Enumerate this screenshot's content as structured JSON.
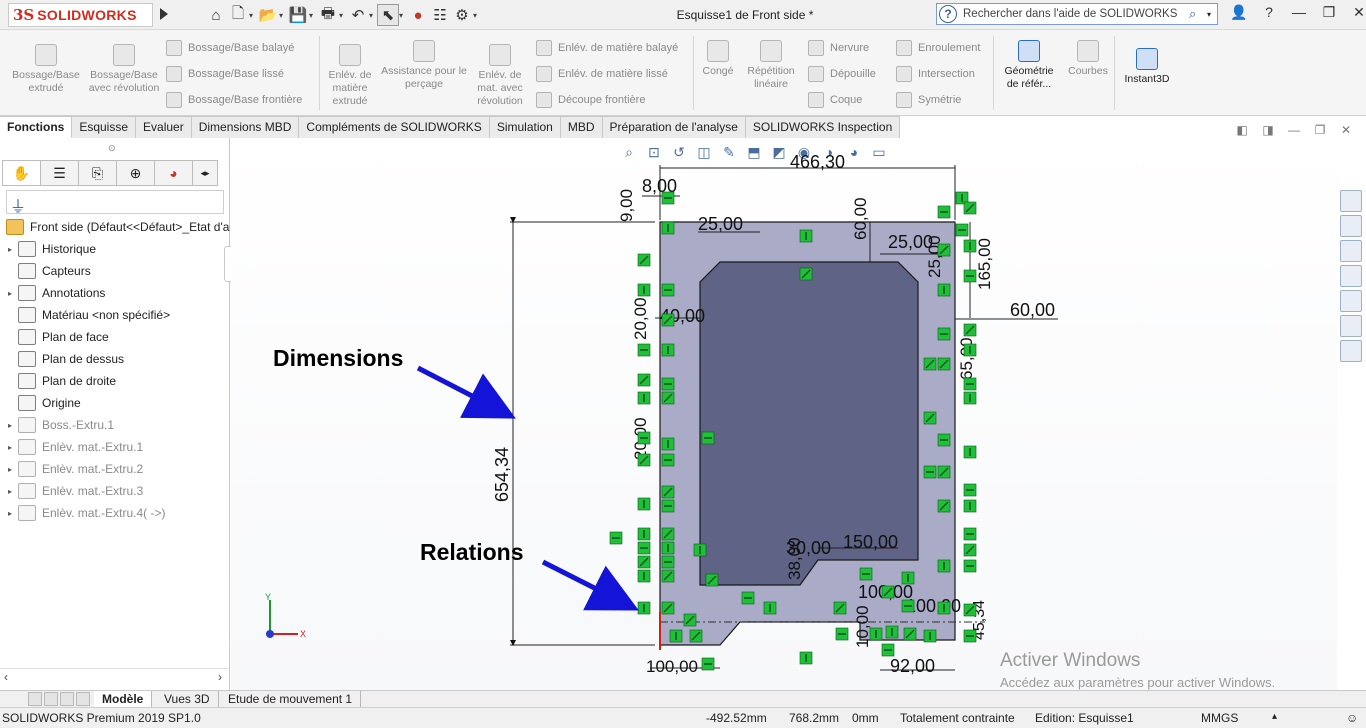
{
  "app": {
    "brand_ds": "3S",
    "brand_name": "SOLIDWORKS",
    "doc_title": "Esquisse1 de Front side *",
    "search_placeholder": "Rechercher dans l'aide de SOLIDWORKS"
  },
  "commands": {
    "bossage_extrude": "Bossage/Base extrudé",
    "bossage_revolution": "Bossage/Base avec révolution",
    "bossage_balaye": "Bossage/Base balayé",
    "bossage_lisse": "Bossage/Base lissé",
    "bossage_frontiere": "Bossage/Base frontière",
    "enlev_extrude": "Enlév. de matière extrudé",
    "assistance_percage": "Assistance pour le perçage",
    "enlev_revolution": "Enlév. de mat. avec révolution",
    "enlev_balaye": "Enlév. de matière balayé",
    "enlev_lisse": "Enlév. de matière lissé",
    "decoupe_frontiere": "Découpe frontière",
    "conge": "Congé",
    "repetition_lineaire": "Répétition linéaire",
    "nervure": "Nervure",
    "depouille": "Dépouille",
    "coque": "Coque",
    "enroulement": "Enroulement",
    "intersection": "Intersection",
    "symetrie": "Symétrie",
    "geometrie_ref": "Géométrie de référ...",
    "courbes": "Courbes",
    "instant3d": "Instant3D"
  },
  "tabs": [
    "Fonctions",
    "Esquisse",
    "Evaluer",
    "Dimensions MBD",
    "Compléments de SOLIDWORKS",
    "Simulation",
    "MBD",
    "Préparation de l'analyse",
    "SOLIDWORKS Inspection"
  ],
  "tree": {
    "root": "Front side  (Défaut<<Défaut>_Etat d'a",
    "items": [
      {
        "label": "Historique",
        "expand": true,
        "dim": false
      },
      {
        "label": "Capteurs",
        "expand": false,
        "dim": false
      },
      {
        "label": "Annotations",
        "expand": true,
        "dim": false
      },
      {
        "label": "Matériau <non spécifié>",
        "expand": false,
        "dim": false
      },
      {
        "label": "Plan de face",
        "expand": false,
        "dim": false
      },
      {
        "label": "Plan de dessus",
        "expand": false,
        "dim": false
      },
      {
        "label": "Plan de droite",
        "expand": false,
        "dim": false
      },
      {
        "label": "Origine",
        "expand": false,
        "dim": false
      },
      {
        "label": "Boss.-Extru.1",
        "expand": true,
        "dim": true
      },
      {
        "label": "Enlèv. mat.-Extru.1",
        "expand": true,
        "dim": true
      },
      {
        "label": "Enlèv. mat.-Extru.2",
        "expand": true,
        "dim": true
      },
      {
        "label": "Enlèv. mat.-Extru.3",
        "expand": true,
        "dim": true
      },
      {
        "label": "Enlèv. mat.-Extru.4( ->)",
        "expand": true,
        "dim": true
      }
    ]
  },
  "callouts": {
    "dimensions": "Dimensions",
    "relations": "Relations"
  },
  "sketch": {
    "dims": {
      "d_466": "466,30",
      "d_8": "8,00",
      "d_9": "9,00",
      "d_25a": "25,00",
      "d_60v": "60,00",
      "d_25b": "25,00",
      "d_25c": "25,00",
      "d_165": "165,00",
      "d_60h": "60,00",
      "d_40": "40,00",
      "d_20a": "20,00",
      "d_654": "654,34",
      "d_150": "150,00",
      "d_30": "30,00",
      "d_38": "38,00",
      "d_100": "100,00",
      "d_20b": "20,00",
      "d_10": "10,00",
      "d_92": "92,00",
      "d_45": "45,34",
      "d_100b": "100,00",
      "d_65": "65,00"
    }
  },
  "bottom_tabs": [
    "Modèle",
    "Vues 3D",
    "Etude de mouvement 1"
  ],
  "status": {
    "version": "SOLIDWORKS Premium 2019 SP1.0",
    "x": "-492.52mm",
    "y": "768.2mm",
    "z": "0mm",
    "state": "Totalement contrainte",
    "edition": "Edition: Esquisse1",
    "units": "MMGS"
  },
  "watermark": {
    "line1": "Activer Windows",
    "line2": "Accédez aux paramètres pour activer Windows."
  },
  "colors": {
    "brand": "#d52b1e",
    "relation_green": "#1fbf3a",
    "sketch_fill": "#a9abc7",
    "arrow_blue": "#1414d8"
  }
}
